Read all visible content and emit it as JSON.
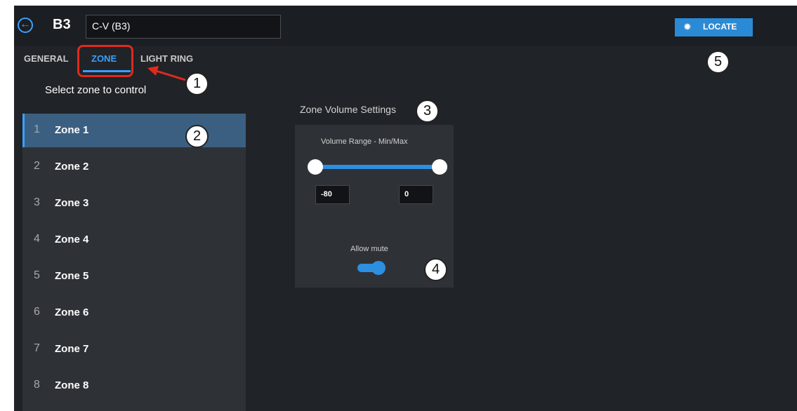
{
  "header": {
    "back_icon": "back-arrow-icon",
    "device_id": "B3",
    "device_name_value": "C-V (B3)",
    "locate_label": "LOCATE",
    "locate_icon": "lightbulb-icon"
  },
  "tabs": [
    {
      "label": "GENERAL",
      "active": false
    },
    {
      "label": "ZONE",
      "active": true
    },
    {
      "label": "LIGHT RING",
      "active": false
    }
  ],
  "zones": {
    "heading": "Select zone to control",
    "items": [
      {
        "num": "1",
        "label": "Zone 1",
        "selected": true
      },
      {
        "num": "2",
        "label": "Zone 2",
        "selected": false
      },
      {
        "num": "3",
        "label": "Zone 3",
        "selected": false
      },
      {
        "num": "4",
        "label": "Zone 4",
        "selected": false
      },
      {
        "num": "5",
        "label": "Zone 5",
        "selected": false
      },
      {
        "num": "6",
        "label": "Zone 6",
        "selected": false
      },
      {
        "num": "7",
        "label": "Zone 7",
        "selected": false
      },
      {
        "num": "8",
        "label": "Zone 8",
        "selected": false
      }
    ]
  },
  "volume": {
    "heading": "Zone Volume Settings",
    "range_label": "Volume Range - Min/Max",
    "min_value": "-80",
    "max_value": "0",
    "mute_label": "Allow mute",
    "mute_enabled": true
  },
  "callouts": [
    "1",
    "2",
    "3",
    "4",
    "5"
  ],
  "colors": {
    "accent": "#3aa0ff",
    "annotation_red": "#e02a1c",
    "background": "#202327",
    "panel": "#2e3237",
    "selected_row": "#3b5f80"
  }
}
